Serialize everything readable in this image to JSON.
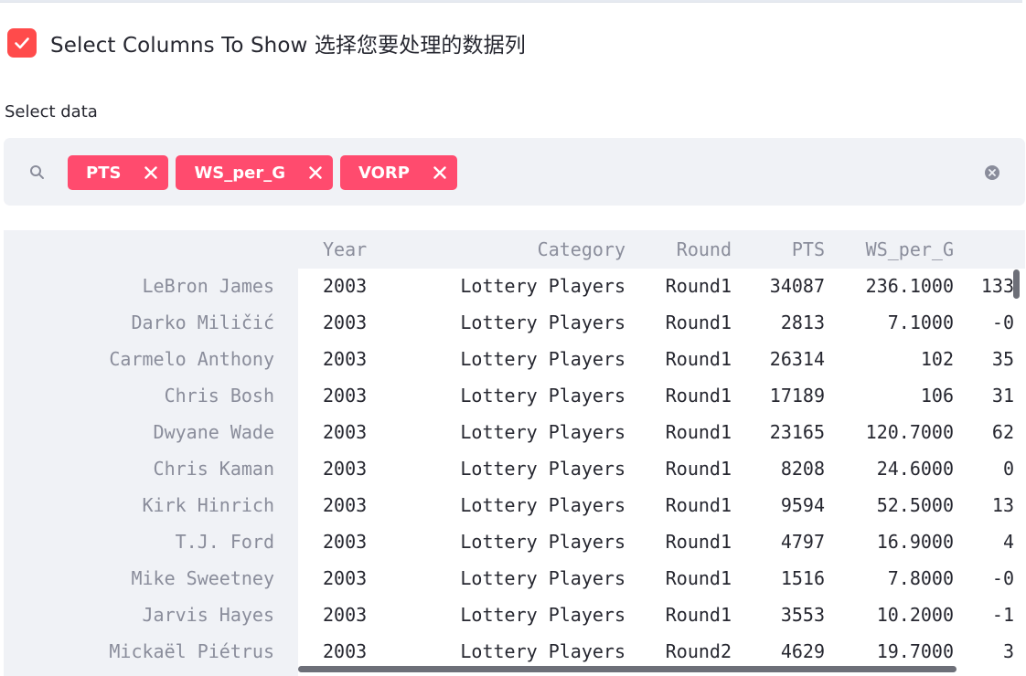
{
  "checkbox": {
    "checked": true,
    "label": "Select Columns To Show 选择您要处理的数据列"
  },
  "multiselect": {
    "label": "Select data",
    "tags": [
      "PTS",
      "WS_per_G",
      "VORP"
    ]
  },
  "table": {
    "columns": [
      "Year",
      "Category",
      "Round",
      "PTS",
      "WS_per_G",
      ""
    ],
    "rows": [
      {
        "name": "LeBron James",
        "year": "2003",
        "category": "Lottery Players",
        "round": "Round1",
        "pts": "34087",
        "ws": "236.1000",
        "vorp": "133"
      },
      {
        "name": "Darko Miličić",
        "year": "2003",
        "category": "Lottery Players",
        "round": "Round1",
        "pts": "2813",
        "ws": "7.1000",
        "vorp": "-0"
      },
      {
        "name": "Carmelo Anthony",
        "year": "2003",
        "category": "Lottery Players",
        "round": "Round1",
        "pts": "26314",
        "ws": "102",
        "vorp": "35"
      },
      {
        "name": "Chris Bosh",
        "year": "2003",
        "category": "Lottery Players",
        "round": "Round1",
        "pts": "17189",
        "ws": "106",
        "vorp": "31"
      },
      {
        "name": "Dwyane Wade",
        "year": "2003",
        "category": "Lottery Players",
        "round": "Round1",
        "pts": "23165",
        "ws": "120.7000",
        "vorp": "62"
      },
      {
        "name": "Chris Kaman",
        "year": "2003",
        "category": "Lottery Players",
        "round": "Round1",
        "pts": "8208",
        "ws": "24.6000",
        "vorp": "0"
      },
      {
        "name": "Kirk Hinrich",
        "year": "2003",
        "category": "Lottery Players",
        "round": "Round1",
        "pts": "9594",
        "ws": "52.5000",
        "vorp": "13"
      },
      {
        "name": "T.J. Ford",
        "year": "2003",
        "category": "Lottery Players",
        "round": "Round1",
        "pts": "4797",
        "ws": "16.9000",
        "vorp": "4"
      },
      {
        "name": "Mike Sweetney",
        "year": "2003",
        "category": "Lottery Players",
        "round": "Round1",
        "pts": "1516",
        "ws": "7.8000",
        "vorp": "-0"
      },
      {
        "name": "Jarvis Hayes",
        "year": "2003",
        "category": "Lottery Players",
        "round": "Round1",
        "pts": "3553",
        "ws": "10.2000",
        "vorp": "-1"
      },
      {
        "name": "Mickaël Piétrus",
        "year": "2003",
        "category": "Lottery Players",
        "round": "Round2",
        "pts": "4629",
        "ws": "19.7000",
        "vorp": "3"
      }
    ]
  },
  "colors": {
    "accent": "#ff4b4b",
    "tag": "#ff4b6e",
    "panel": "#f0f2f6",
    "muted_text": "#8a8d9b"
  }
}
